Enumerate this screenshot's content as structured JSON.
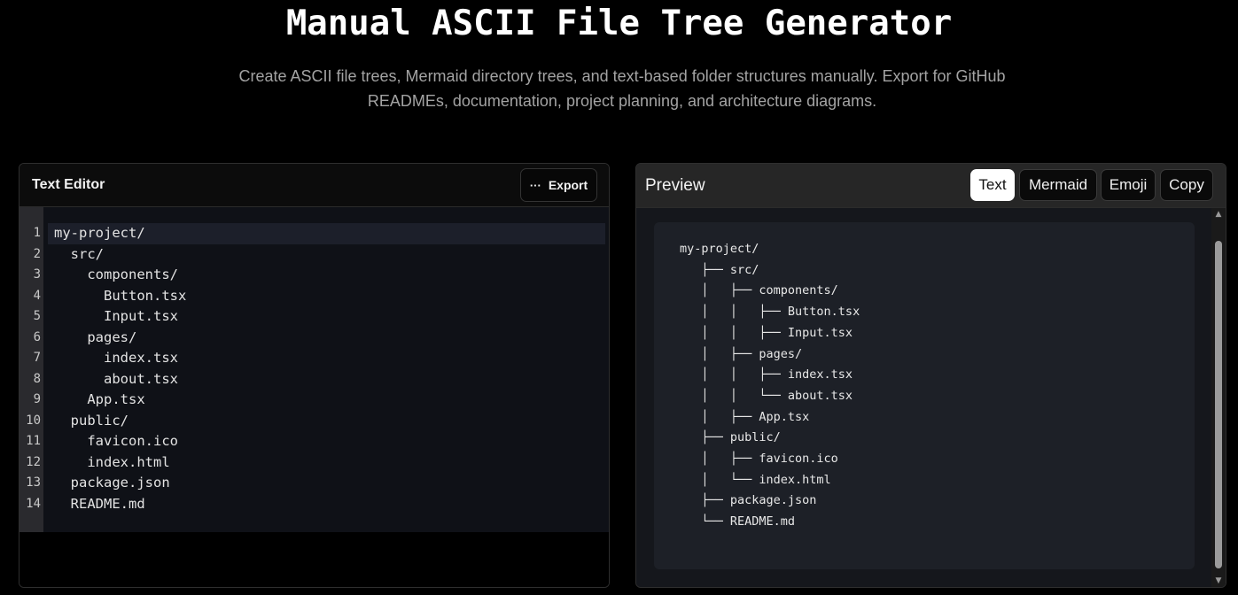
{
  "page": {
    "title": "Manual ASCII File Tree Generator",
    "subtitle_line1": "Create ASCII file trees, Mermaid directory trees, and text-based folder structures manually. Export for GitHub",
    "subtitle_line2": "READMEs, documentation, project planning, and architecture diagrams."
  },
  "editor": {
    "title": "Text Editor",
    "export_label": "Export",
    "lines": [
      {
        "num": "1",
        "text": "my-project/"
      },
      {
        "num": "2",
        "text": "  src/"
      },
      {
        "num": "3",
        "text": "    components/"
      },
      {
        "num": "4",
        "text": "      Button.tsx"
      },
      {
        "num": "5",
        "text": "      Input.tsx"
      },
      {
        "num": "6",
        "text": "    pages/"
      },
      {
        "num": "7",
        "text": "      index.tsx"
      },
      {
        "num": "8",
        "text": "      about.tsx"
      },
      {
        "num": "9",
        "text": "    App.tsx"
      },
      {
        "num": "10",
        "text": "  public/"
      },
      {
        "num": "11",
        "text": "    favicon.ico"
      },
      {
        "num": "12",
        "text": "    index.html"
      },
      {
        "num": "13",
        "text": "  package.json"
      },
      {
        "num": "14",
        "text": "  README.md"
      }
    ]
  },
  "preview": {
    "title": "Preview",
    "tabs": [
      {
        "label": "Text",
        "selected": true
      },
      {
        "label": "Mermaid",
        "selected": false
      },
      {
        "label": "Emoji",
        "selected": false
      },
      {
        "label": "Copy",
        "selected": false
      }
    ],
    "tree_lines": [
      "my-project/",
      "   ├── src/",
      "   │   ├── components/",
      "   │   │   ├── Button.tsx",
      "   │   │   ├── Input.tsx",
      "   │   ├── pages/",
      "   │   │   ├── index.tsx",
      "   │   │   └── about.tsx",
      "   │   ├── App.tsx",
      "   ├── public/",
      "   │   ├── favicon.ico",
      "   │   └── index.html",
      "   ├── package.json",
      "   └── README.md"
    ]
  },
  "icons": {
    "export": "dots-horizontal-icon",
    "scroll_up": "triangle-up-icon",
    "scroll_down": "triangle-down-icon"
  }
}
